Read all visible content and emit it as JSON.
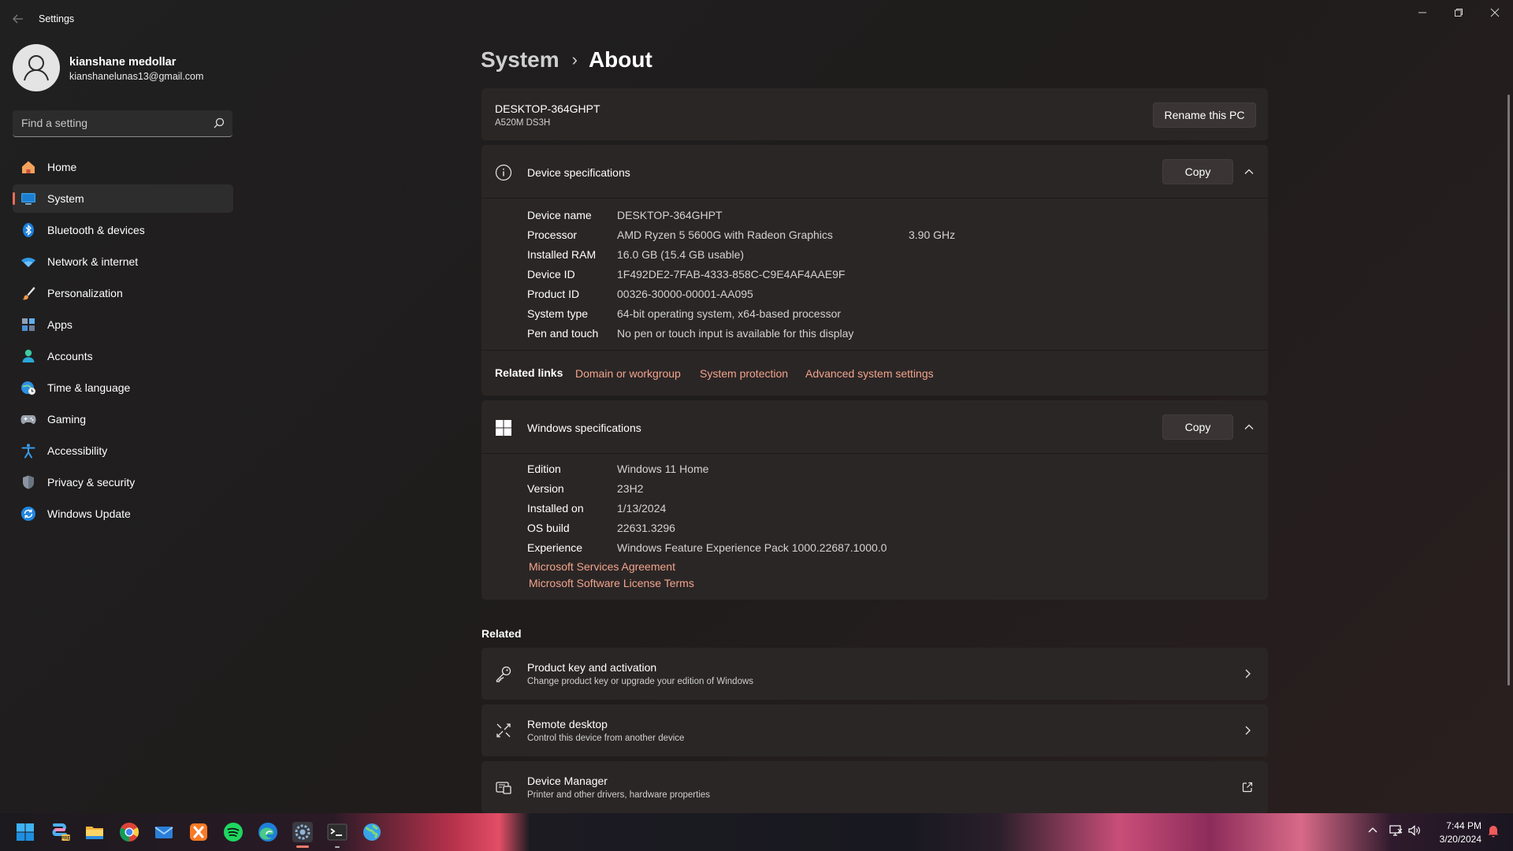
{
  "app": {
    "title": "Settings"
  },
  "window_controls": {
    "minimize": "minimize",
    "maximize": "restore",
    "close": "close"
  },
  "profile": {
    "name": "kianshane medollar",
    "email": "kianshanelunas13@gmail.com"
  },
  "search": {
    "placeholder": "Find a setting"
  },
  "nav": [
    {
      "label": "Home",
      "icon": "home-icon"
    },
    {
      "label": "System",
      "icon": "system-icon",
      "active": true
    },
    {
      "label": "Bluetooth & devices",
      "icon": "bluetooth-icon"
    },
    {
      "label": "Network & internet",
      "icon": "wifi-icon"
    },
    {
      "label": "Personalization",
      "icon": "brush-icon"
    },
    {
      "label": "Apps",
      "icon": "apps-icon"
    },
    {
      "label": "Accounts",
      "icon": "accounts-icon"
    },
    {
      "label": "Time & language",
      "icon": "globe-clock-icon"
    },
    {
      "label": "Gaming",
      "icon": "gamepad-icon"
    },
    {
      "label": "Accessibility",
      "icon": "accessibility-icon"
    },
    {
      "label": "Privacy & security",
      "icon": "shield-icon"
    },
    {
      "label": "Windows Update",
      "icon": "update-icon"
    }
  ],
  "breadcrumb": {
    "parent": "System",
    "separator": "›",
    "current": "About"
  },
  "pc": {
    "name": "DESKTOP-364GHPT",
    "model": "A520M DS3H",
    "rename_label": "Rename this PC"
  },
  "device_specs": {
    "title": "Device specifications",
    "copy_label": "Copy",
    "rows": [
      {
        "label": "Device name",
        "value": "DESKTOP-364GHPT",
        "extra": ""
      },
      {
        "label": "Processor",
        "value": "AMD Ryzen 5 5600G with Radeon Graphics",
        "extra": "3.90 GHz"
      },
      {
        "label": "Installed RAM",
        "value": "16.0 GB (15.4 GB usable)",
        "extra": ""
      },
      {
        "label": "Device ID",
        "value": "1F492DE2-7FAB-4333-858C-C9E4AF4AAE9F",
        "extra": ""
      },
      {
        "label": "Product ID",
        "value": "00326-30000-00001-AA095",
        "extra": ""
      },
      {
        "label": "System type",
        "value": "64-bit operating system, x64-based processor",
        "extra": ""
      },
      {
        "label": "Pen and touch",
        "value": "No pen or touch input is available for this display",
        "extra": ""
      }
    ]
  },
  "related_links": {
    "title": "Related links",
    "links": [
      "Domain or workgroup",
      "System protection",
      "Advanced system settings"
    ]
  },
  "windows_specs": {
    "title": "Windows specifications",
    "copy_label": "Copy",
    "rows": [
      {
        "label": "Edition",
        "value": "Windows 11 Home"
      },
      {
        "label": "Version",
        "value": "23H2"
      },
      {
        "label": "Installed on",
        "value": "1/13/2024"
      },
      {
        "label": "OS build",
        "value": "22631.3296"
      },
      {
        "label": "Experience",
        "value": "Windows Feature Experience Pack 1000.22687.1000.0"
      }
    ],
    "links": [
      "Microsoft Services Agreement",
      "Microsoft Software License Terms"
    ]
  },
  "related": {
    "title": "Related",
    "items": [
      {
        "title": "Product key and activation",
        "subtitle": "Change product key or upgrade your edition of Windows",
        "icon": "key-icon",
        "action": "chevron-right-icon"
      },
      {
        "title": "Remote desktop",
        "subtitle": "Control this device from another device",
        "icon": "remote-desktop-icon",
        "action": "chevron-right-icon"
      },
      {
        "title": "Device Manager",
        "subtitle": "Printer and other drivers, hardware properties",
        "icon": "device-manager-icon",
        "action": "external-link-icon"
      }
    ]
  },
  "taskbar": {
    "apps": [
      "windows-start-icon",
      "copilot-icon",
      "file-explorer-icon",
      "chrome-icon",
      "mail-icon",
      "xampp-icon",
      "spotify-icon",
      "edge-icon",
      "settings-icon",
      "terminal-icon",
      "globe-app-icon"
    ],
    "active_app": "settings-icon",
    "clock": {
      "time": "7:44 PM",
      "date": "3/20/2024"
    }
  },
  "colors": {
    "accent": "#e86c5a",
    "link": "#f2a48c",
    "card": "#2b2626"
  }
}
